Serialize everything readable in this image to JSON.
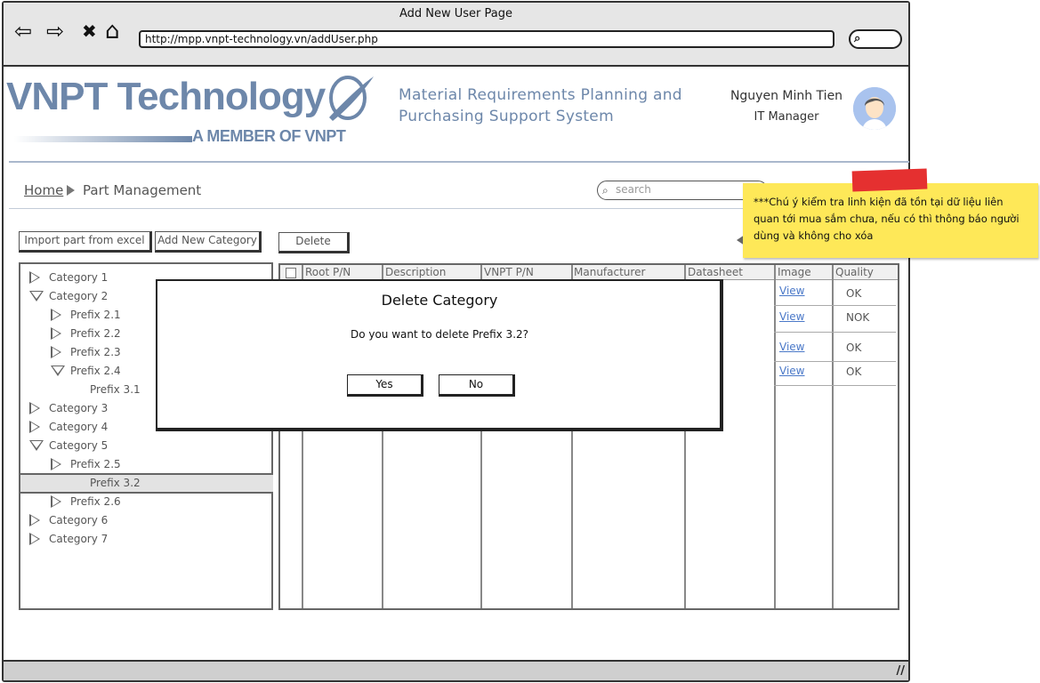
{
  "window": {
    "title": "Add New User Page",
    "url": "http://mpp.vnpt-technology.vn/addUser.php",
    "nav": {
      "back": "⇦",
      "forward": "⇨",
      "close": "✖",
      "home": "⌂"
    }
  },
  "header": {
    "logo_text": "VNPT Technology",
    "logo_subtitle": "A MEMBER OF VNPT",
    "system_title": "Material Requirements Planning and Purchasing Support System",
    "user_name": "Nguyen Minh Tien",
    "user_role": "IT Manager"
  },
  "breadcrumb": {
    "home": "Home",
    "current": "Part Management"
  },
  "search": {
    "placeholder": "search"
  },
  "toolbar": {
    "import_label": "Import part from excel",
    "add_category_label": "Add New Category",
    "delete_label": "Delete"
  },
  "tree": {
    "items": [
      {
        "label": "Category 1",
        "level": 0,
        "state": "collapsed"
      },
      {
        "label": "Category 2",
        "level": 0,
        "state": "expanded"
      },
      {
        "label": "Prefix 2.1",
        "level": 1,
        "state": "collapsed"
      },
      {
        "label": "Prefix 2.2",
        "level": 1,
        "state": "collapsed"
      },
      {
        "label": "Prefix 2.3",
        "level": 1,
        "state": "collapsed"
      },
      {
        "label": "Prefix 2.4",
        "level": 1,
        "state": "expanded"
      },
      {
        "label": "Prefix 3.1",
        "level": 2,
        "state": "leaf"
      },
      {
        "label": "Category 3",
        "level": 0,
        "state": "collapsed"
      },
      {
        "label": "Category 4",
        "level": 0,
        "state": "collapsed"
      },
      {
        "label": "Category 5",
        "level": 0,
        "state": "expanded"
      },
      {
        "label": "Prefix 2.5",
        "level": 1,
        "state": "collapsed"
      },
      {
        "label": "Prefix 3.2",
        "level": 2,
        "state": "leaf",
        "selected": true
      },
      {
        "label": "Prefix 2.6",
        "level": 1,
        "state": "collapsed"
      },
      {
        "label": "Category 6",
        "level": 0,
        "state": "collapsed"
      },
      {
        "label": "Category 7",
        "level": 0,
        "state": "collapsed"
      }
    ]
  },
  "table": {
    "columns": [
      "Root P/N",
      "Description",
      "VNPT P/N",
      "Manufacturer",
      "Datasheet",
      "Image",
      "Quality"
    ],
    "rows": [
      {
        "image": "View",
        "quality": "OK"
      },
      {
        "image": "View",
        "quality": "NOK"
      },
      {
        "image": "View",
        "quality": "OK"
      },
      {
        "image": "View",
        "quality": "OK"
      }
    ]
  },
  "dialog": {
    "title": "Delete Category",
    "message": "Do you want to delete Prefix 3.2?",
    "yes_label": "Yes",
    "no_label": "No"
  },
  "sticky_note": {
    "text": "***Chú ý kiểm tra linh kiện đã tồn tại dữ liệu liên quan tới mua sắm chưa, nếu có thì thông báo người dùng và không cho xóa"
  },
  "colors": {
    "brand": "#6d87aa",
    "link": "#4a78c8",
    "sticky": "#fee858",
    "tape": "#e53030"
  }
}
